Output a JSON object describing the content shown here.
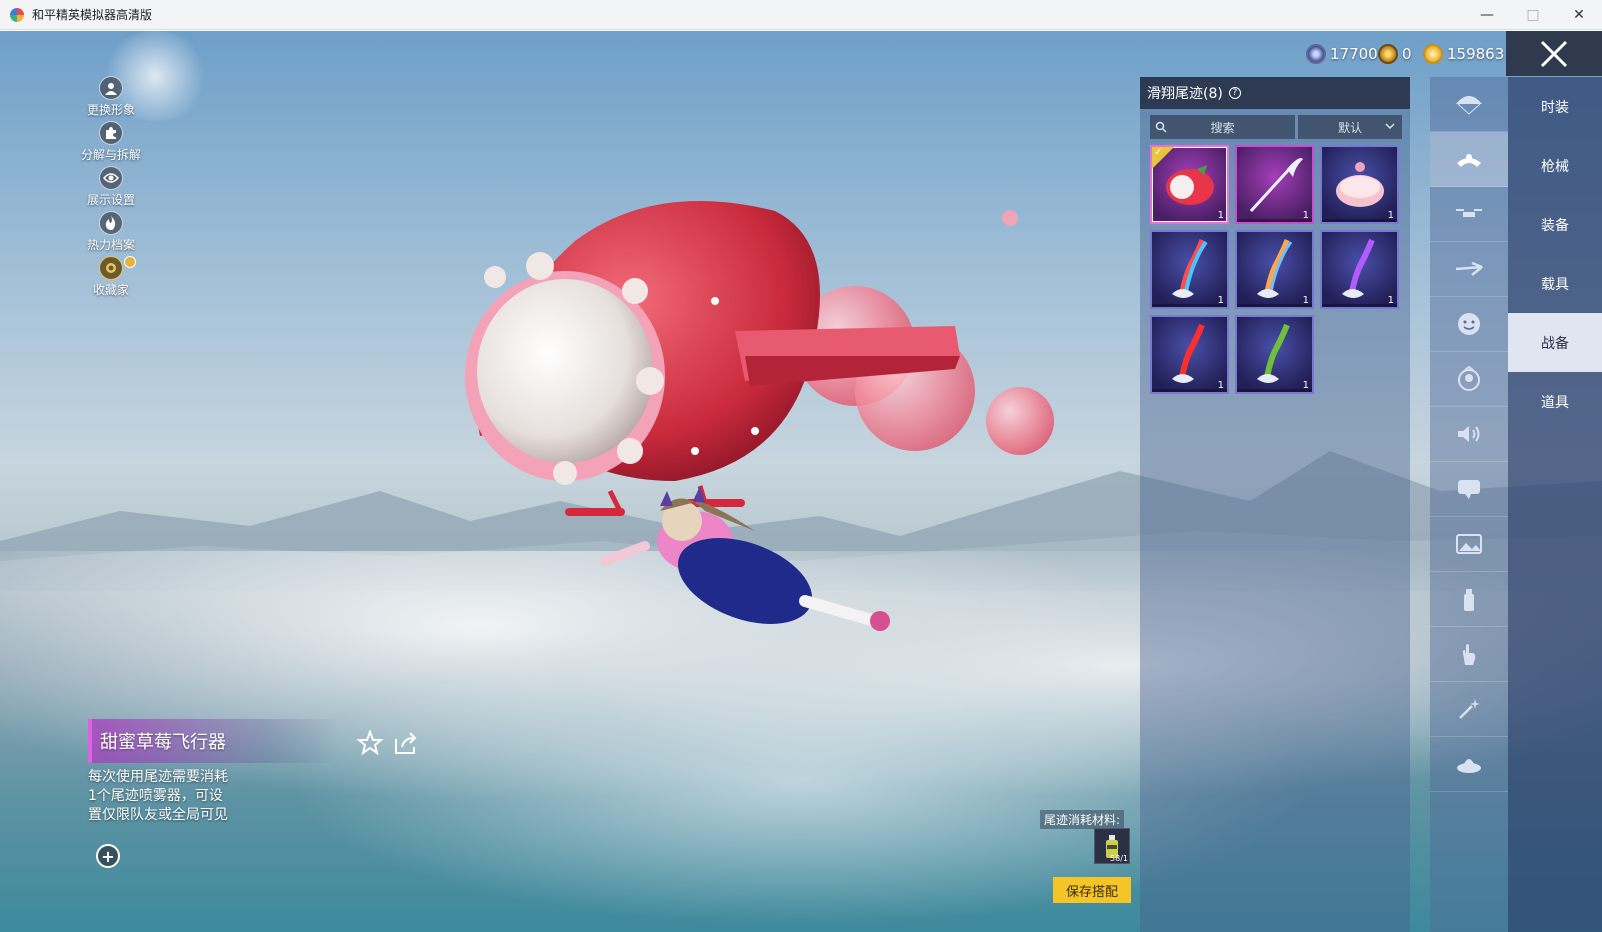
{
  "window": {
    "title": "和平精英模拟器高清版"
  },
  "currency": [
    {
      "icon": "silver-coin-icon",
      "value": "17700"
    },
    {
      "icon": "gold-token-icon",
      "value": "0"
    },
    {
      "icon": "gold-coupon-icon",
      "value": "159863"
    }
  ],
  "left_menu": [
    {
      "icon": "person-icon",
      "label": "更换形象"
    },
    {
      "icon": "puzzle-icon",
      "label": "分解与拆解"
    },
    {
      "icon": "eye-icon",
      "label": "展示设置"
    },
    {
      "icon": "flame-icon",
      "label": "热力档案"
    },
    {
      "icon": "collector-icon",
      "label": "收藏家"
    }
  ],
  "item": {
    "name": "甜蜜草莓飞行器",
    "description_lines": [
      "每次使用尾迹需要消耗",
      "1个尾迹喷雾器，可设",
      "置仅限队友或全局可见"
    ]
  },
  "panel": {
    "title": "滑翔尾迹(8)",
    "search_placeholder": "搜索",
    "sort_label": "默认",
    "items": [
      {
        "name": "strawberry-trail",
        "qty": "1",
        "rarity": "legendary",
        "selected": true
      },
      {
        "name": "wing-staff-trail",
        "qty": "1",
        "rarity": "legendary"
      },
      {
        "name": "cake-trail",
        "qty": "1",
        "rarity": "epic"
      },
      {
        "name": "rainbow-smoke-trail",
        "qty": "1",
        "rarity": "epic"
      },
      {
        "name": "orange-smoke-trail",
        "qty": "1",
        "rarity": "epic"
      },
      {
        "name": "purple-smoke-trail",
        "qty": "1",
        "rarity": "epic"
      },
      {
        "name": "red-smoke-trail",
        "qty": "1",
        "rarity": "epic"
      },
      {
        "name": "green-smoke-trail",
        "qty": "1",
        "rarity": "epic"
      }
    ],
    "consume_label": "尾迹消耗材料:",
    "consume_count": "58/1",
    "save_label": "保存搭配"
  },
  "icon_column": [
    {
      "icon": "parachute-icon",
      "active": false
    },
    {
      "icon": "glide-trail-icon",
      "active": true
    },
    {
      "icon": "drone-icon",
      "active": false
    },
    {
      "icon": "plane-icon",
      "active": false
    },
    {
      "icon": "emoji-icon",
      "active": false
    },
    {
      "icon": "avatar-frame-icon",
      "active": false
    },
    {
      "icon": "voice-icon",
      "active": false
    },
    {
      "icon": "chat-bubble-icon",
      "active": false
    },
    {
      "icon": "gallery-icon",
      "active": false
    },
    {
      "icon": "spray-icon",
      "active": false
    },
    {
      "icon": "hand-gesture-icon",
      "active": false
    },
    {
      "icon": "sparkle-wand-icon",
      "active": false
    },
    {
      "icon": "landing-icon",
      "active": false
    }
  ],
  "tabs": [
    {
      "label": "时装",
      "active": false
    },
    {
      "label": "枪械",
      "active": false
    },
    {
      "label": "装备",
      "active": false
    },
    {
      "label": "载具",
      "active": false
    },
    {
      "label": "战备",
      "active": true
    },
    {
      "label": "道具",
      "active": false
    }
  ]
}
